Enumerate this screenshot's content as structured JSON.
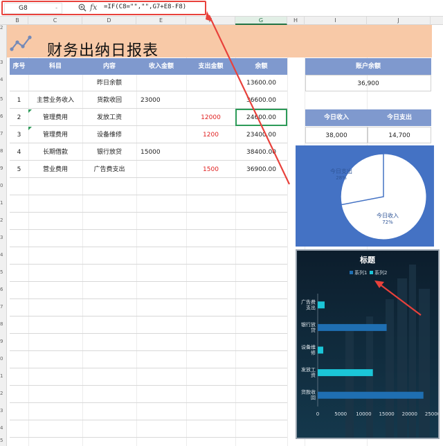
{
  "formula_bar": {
    "name_box": "G8",
    "name_box_arrow": "-",
    "fx_label": "fx",
    "formula": "=IF(C8=\"\",\"\",G7+E8-F8)"
  },
  "columns": [
    "B",
    "C",
    "D",
    "E",
    "F",
    "G",
    "H",
    "I",
    "J"
  ],
  "selected_column": "G",
  "row_numbers": [
    "2",
    "3",
    "4",
    "5",
    "6",
    "7",
    "8",
    "9",
    "0",
    "1",
    "2",
    "3",
    "4",
    "5",
    "6",
    "7",
    "8",
    "9",
    "0",
    "1",
    "2",
    "3",
    "4",
    "5",
    "6",
    "7"
  ],
  "banner": {
    "title": "财务出纳日报表",
    "icon": "line-chart-icon",
    "bg_color": "#f8c9a7"
  },
  "table": {
    "headers": [
      "序号",
      "科目",
      "内容",
      "收入金额",
      "支出金额",
      "余额"
    ],
    "rows": [
      {
        "no": "",
        "subject": "",
        "content": "昨日余额",
        "income": "",
        "expense": "",
        "balance": "13600.00"
      },
      {
        "no": "1",
        "subject": "主营业务收入",
        "content": "货款收回",
        "income": "23000",
        "expense": "",
        "balance": "36600.00"
      },
      {
        "no": "2",
        "subject": "管理费用",
        "content": "发放工资",
        "income": "",
        "expense": "12000",
        "balance": "24600.00"
      },
      {
        "no": "3",
        "subject": "管理费用",
        "content": "设备维修",
        "income": "",
        "expense": "1200",
        "balance": "23400.00"
      },
      {
        "no": "4",
        "subject": "长期借款",
        "content": "银行放贷",
        "income": "15000",
        "expense": "",
        "balance": "38400.00"
      },
      {
        "no": "5",
        "subject": "营业费用",
        "content": "广告费支出",
        "income": "",
        "expense": "1500",
        "balance": "36900.00"
      }
    ],
    "header_color": "#7f99ce",
    "expense_color": "#e02020"
  },
  "account_balance": {
    "label": "账户余额",
    "value": "36,900"
  },
  "today": {
    "income_label": "今日收入",
    "expense_label": "今日支出",
    "income_value": "38,000",
    "expense_value": "14,700"
  },
  "chart_data": [
    {
      "type": "pie",
      "labels": [
        "今日支出",
        "今日收入"
      ],
      "values": [
        28,
        72
      ],
      "percent_labels": [
        "28%",
        "72%"
      ],
      "colors": [
        "#ffffff",
        "#ffffff"
      ],
      "background": "#4472c4"
    },
    {
      "type": "bar",
      "orientation": "horizontal",
      "title": "标题",
      "categories": [
        "货款收回",
        "发放工资",
        "设备维修",
        "银行放贷",
        "广告费支出"
      ],
      "category_labels": [
        [
          "货款收",
          "回"
        ],
        [
          "发放工",
          "资"
        ],
        [
          "设备维",
          "修"
        ],
        [
          "银行放",
          "贷"
        ],
        [
          "广告费",
          "支出"
        ]
      ],
      "series": [
        {
          "name": "系列1",
          "values": [
            23000,
            0,
            0,
            15000,
            0
          ],
          "color": "#1f6fb2"
        },
        {
          "name": "系列2",
          "values": [
            0,
            12000,
            1200,
            0,
            1500
          ],
          "color": "#1bc6d8"
        }
      ],
      "xlim": [
        0,
        25000
      ],
      "xticks": [
        "0",
        "5000",
        "10000",
        "15000",
        "20000",
        "25000"
      ],
      "legend": "top"
    }
  ]
}
